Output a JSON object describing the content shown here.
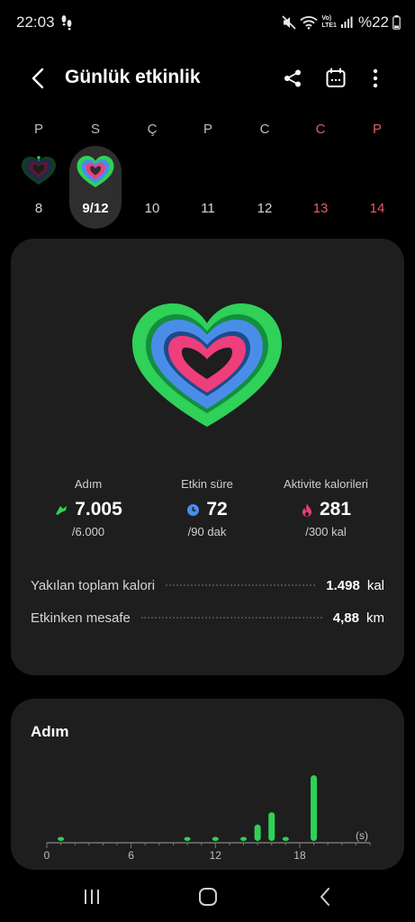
{
  "status_bar": {
    "time": "22:03",
    "network_label_top": "Vo)",
    "network_label_bottom": "LTE1",
    "battery": "%22"
  },
  "app_bar": {
    "title": "Günlük etkinlik"
  },
  "week": {
    "days": [
      {
        "letter": "P",
        "number": "8",
        "weekend": false,
        "has_ring": true
      },
      {
        "letter": "S",
        "number": "9/12",
        "weekend": false,
        "has_ring": true,
        "selected": true
      },
      {
        "letter": "Ç",
        "number": "10",
        "weekend": false,
        "has_ring": false
      },
      {
        "letter": "P",
        "number": "11",
        "weekend": false,
        "has_ring": false
      },
      {
        "letter": "C",
        "number": "12",
        "weekend": false,
        "has_ring": false
      },
      {
        "letter": "C",
        "number": "13",
        "weekend": true,
        "has_ring": false
      },
      {
        "letter": "P",
        "number": "14",
        "weekend": true,
        "has_ring": false
      }
    ]
  },
  "stats": {
    "steps": {
      "label": "Adım",
      "value": "7.005",
      "goal": "/6.000",
      "progress": 1.17
    },
    "active_time": {
      "label": "Etkin süre",
      "value": "72",
      "goal": "/90 dak",
      "progress": 0.8
    },
    "calories": {
      "label": "Aktivite kalorileri",
      "value": "281",
      "goal": "/300 kal",
      "progress": 0.94
    }
  },
  "summary": {
    "total_calories": {
      "label": "Yakılan toplam kalori",
      "value": "1.498",
      "unit": "kal"
    },
    "distance": {
      "label": "Etkinken mesafe",
      "value": "4,88",
      "unit": "km"
    }
  },
  "steps_card": {
    "title": "Adım"
  },
  "colors": {
    "steps": "#2fd158",
    "active_time": "#4a8de8",
    "calories": "#ee3e7c",
    "background": "#000000",
    "card": "#1e1e1e"
  },
  "chart_data": {
    "type": "bar",
    "xlabel": "(s)",
    "x_ticks": [
      "0",
      "6",
      "12",
      "18"
    ],
    "xlim": [
      0,
      23
    ],
    "x": [
      1,
      10,
      12,
      14,
      15,
      16,
      17,
      19
    ],
    "values": [
      1,
      1,
      1,
      1,
      4,
      7,
      1,
      16
    ],
    "ylim": [
      0,
      16
    ],
    "color": "#2fd158"
  }
}
